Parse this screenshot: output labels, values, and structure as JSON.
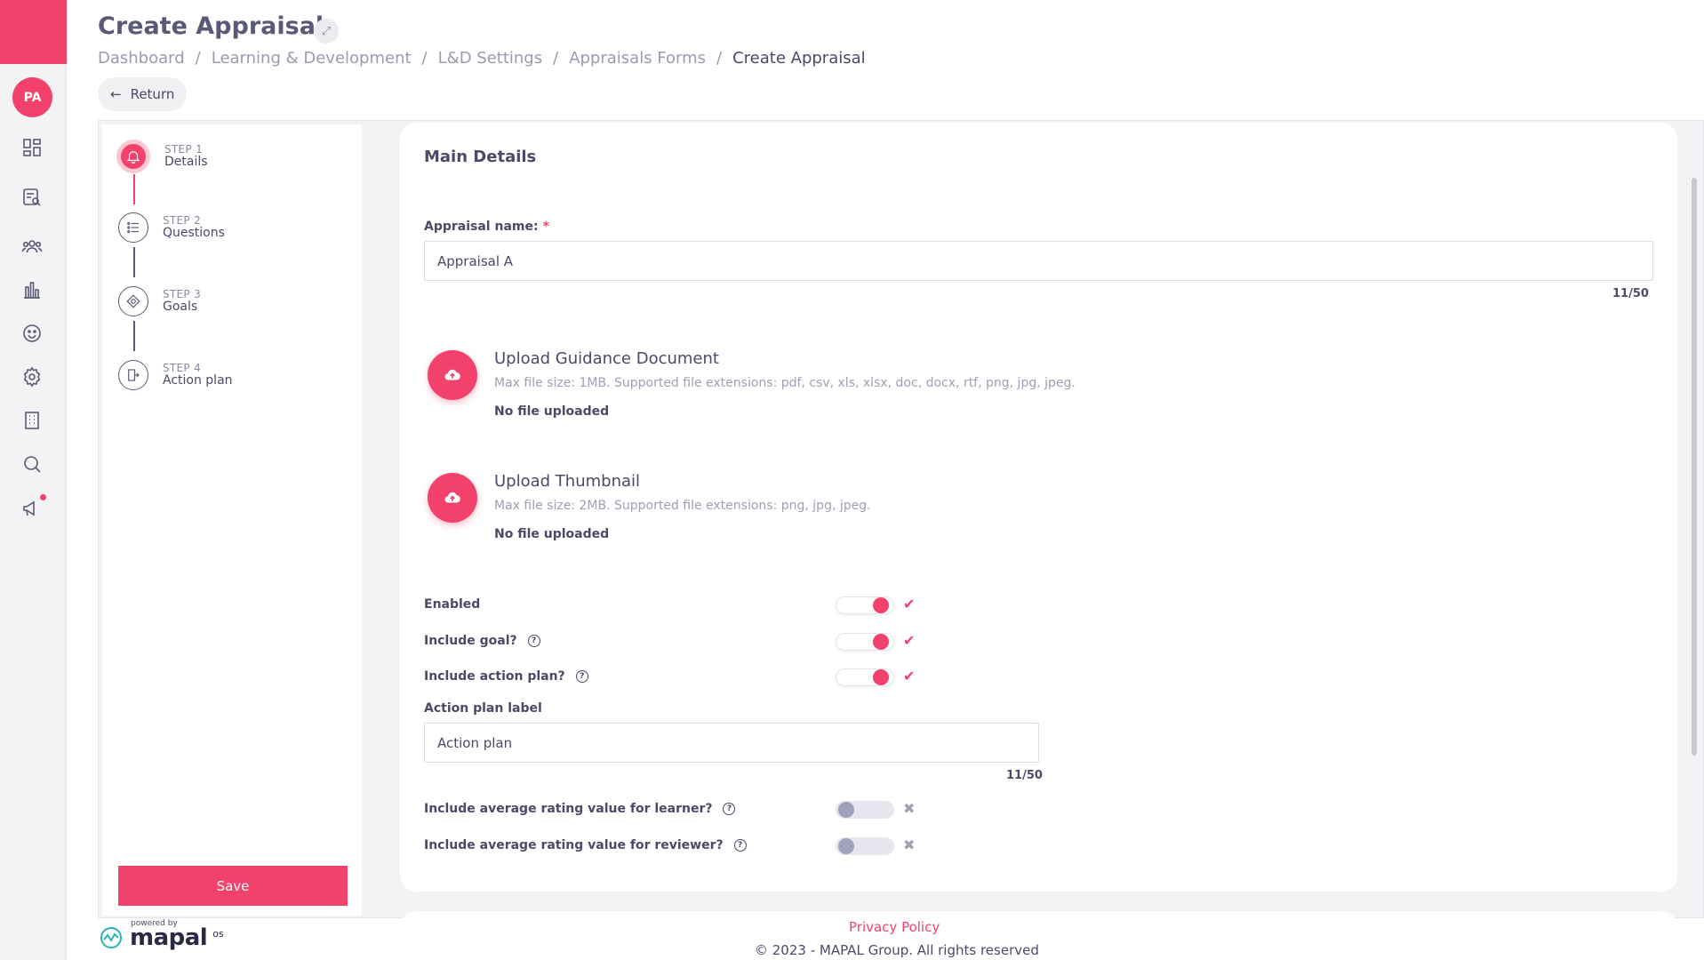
{
  "brand_color": "#f2416b",
  "user": {
    "initials": "PA"
  },
  "nav_icons": [
    "dashboard-icon",
    "search-document-icon",
    "people-icon",
    "chart-icon",
    "smiley-icon",
    "gear-icon",
    "building-icon",
    "search-icon",
    "megaphone-icon"
  ],
  "header": {
    "title": "Create Appraisal",
    "breadcrumb": [
      "Dashboard",
      "Learning & Development",
      "L&D Settings",
      "Appraisals Forms",
      "Create Appraisal"
    ],
    "return_label": "Return"
  },
  "stepper": {
    "steps": [
      {
        "num": "STEP 1",
        "name": "Details",
        "active": true
      },
      {
        "num": "STEP 2",
        "name": "Questions",
        "active": false
      },
      {
        "num": "STEP 3",
        "name": "Goals",
        "active": false
      },
      {
        "num": "STEP 4",
        "name": "Action plan",
        "active": false
      }
    ],
    "save_label": "Save"
  },
  "main": {
    "section_title": "Main Details",
    "appraisal_name": {
      "label": "Appraisal name:",
      "required_mark": "*",
      "value": "Appraisal A",
      "counter": "11/50"
    },
    "uploads": [
      {
        "title": "Upload Guidance Document",
        "hint": "Max file size: 1MB. Supported file extensions: pdf, csv, xls, xlsx, doc, docx, rtf, png, jpg, jpeg.",
        "status": "No file uploaded"
      },
      {
        "title": "Upload Thumbnail",
        "hint": "Max file size: 2MB. Supported file extensions: png, jpg, jpeg.",
        "status": "No file uploaded"
      }
    ],
    "toggles": [
      {
        "label": "Enabled",
        "help": false,
        "on": true
      },
      {
        "label": "Include goal?",
        "help": true,
        "on": true
      },
      {
        "label": "Include action plan?",
        "help": true,
        "on": true
      }
    ],
    "action_plan_label": {
      "label": "Action plan label",
      "value": "Action plan",
      "counter": "11/50"
    },
    "rating_toggles": [
      {
        "label": "Include average rating value for learner?",
        "help": true,
        "on": false
      },
      {
        "label": "Include average rating value for reviewer?",
        "help": true,
        "on": false
      }
    ]
  },
  "footer": {
    "powered_by": "powered by",
    "brand": "mapal",
    "brand_suffix": "os",
    "privacy": "Privacy Policy",
    "copyright": "© 2023 - MAPAL Group. All rights reserved"
  }
}
